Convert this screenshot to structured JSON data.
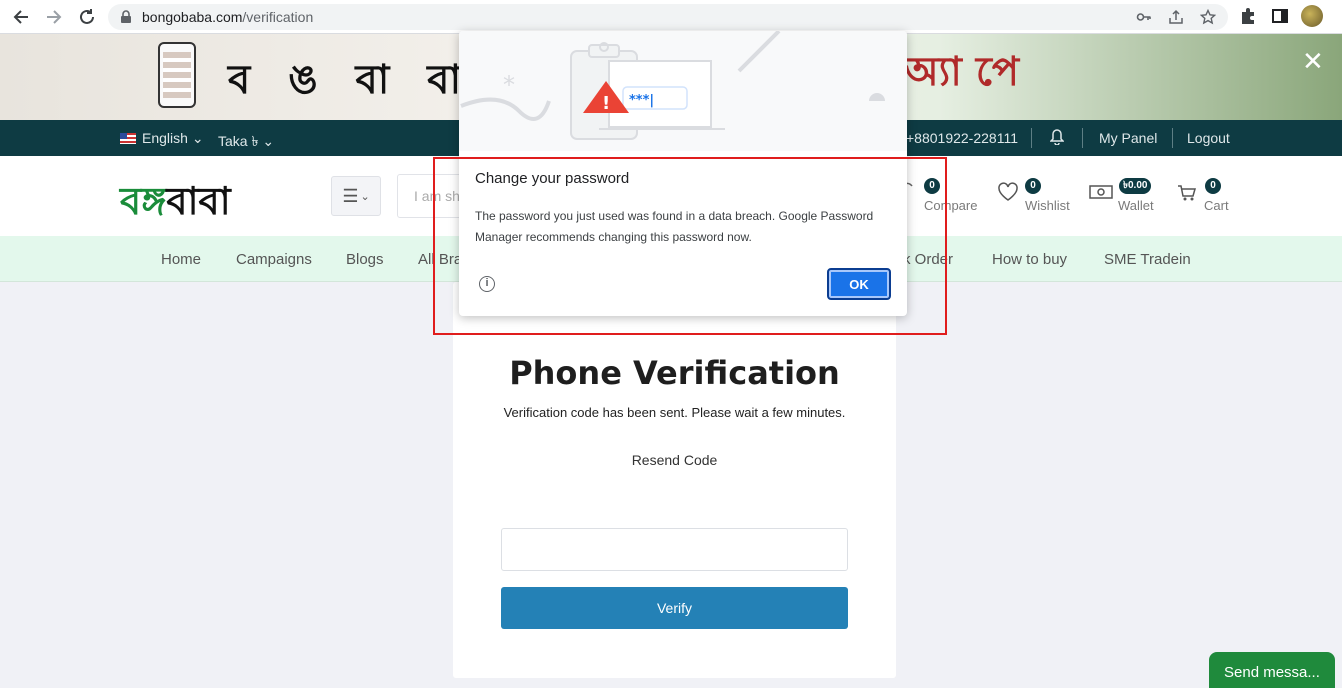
{
  "browser": {
    "url_domain": "bongobaba.com",
    "url_path": "/verification"
  },
  "banner": {
    "text_left": "ব ঙ বা বা",
    "text_right": "অ্যাপে"
  },
  "topbar": {
    "language": "English",
    "currency": "Taka ৳",
    "phone": "+8801922-228111",
    "my_panel": "My Panel",
    "logout": "Logout"
  },
  "header": {
    "logo_green": "বঙ্গ",
    "logo_black": "বাবা",
    "search_placeholder": "I am sh",
    "compare_label": "Compare",
    "compare_count": "0",
    "wishlist_label": "Wishlist",
    "wishlist_count": "0",
    "wallet_label": "Wallet",
    "wallet_amount": "৳0.00",
    "cart_label": "Cart",
    "cart_count": "0"
  },
  "mainnav": {
    "items": [
      "Home",
      "Campaigns",
      "Blogs",
      "All Bra",
      "k Order",
      "How to buy",
      "SME Tradein"
    ]
  },
  "verification": {
    "title": "Phone Verification",
    "subtitle": "Verification code has been sent. Please wait a few minutes.",
    "resend": "Resend Code",
    "verify_button": "Verify"
  },
  "chat": {
    "label": "Send messa..."
  },
  "dialog": {
    "title": "Change your password",
    "body": "The password you just used was found in a data breach. Google Password Manager recommends changing this password now.",
    "ok_label": "OK",
    "masked": "***|"
  },
  "colors": {
    "topbar": "#0e3b43",
    "nav_bg": "#e3f8ec",
    "verify_button": "#2481b6",
    "dialog_ok": "#1a73e8",
    "highlight": "#e01d1d",
    "chat": "#1f8a3c"
  }
}
